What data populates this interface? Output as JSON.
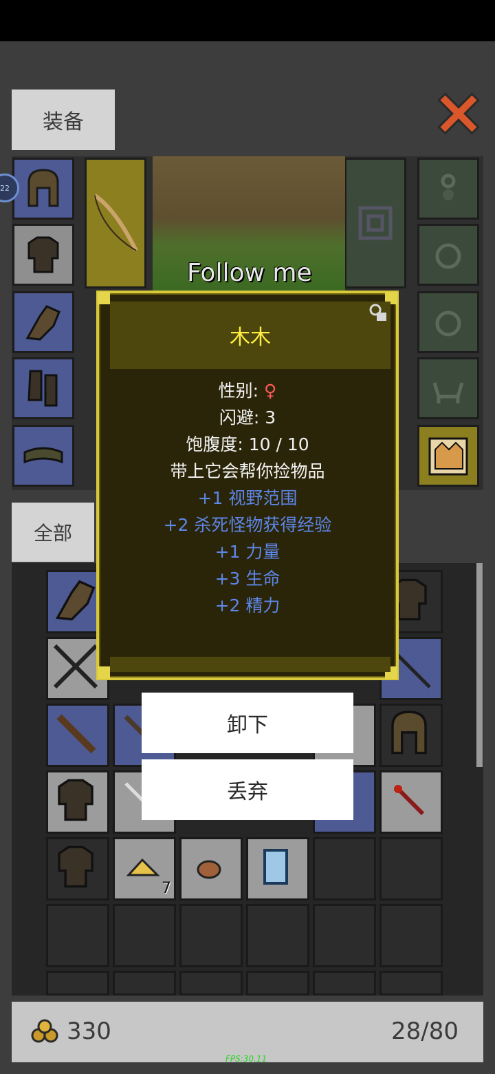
{
  "tabs": {
    "equipment": "装备",
    "all": "全部"
  },
  "scene": {
    "caption": "Follow me"
  },
  "badge": {
    "text": "22"
  },
  "tooltip": {
    "title": "木木",
    "gender_label": "性别: ",
    "gender_symbol": "♀",
    "dodge": "闪避: 3",
    "satiety": "饱腹度: 10 / 10",
    "description": "带上它会帮你捡物品",
    "bonuses": [
      "+1 视野范围",
      "+2 杀死怪物获得经验",
      "+1 力量",
      "+3 生命",
      "+2 精力"
    ]
  },
  "actions": {
    "unequip": "卸下",
    "drop": "丢弃"
  },
  "inventory": {
    "gold": "330",
    "capacity": "28/80",
    "gold_qty_item": "7"
  },
  "fps": "FPS:30.11",
  "colors": {
    "title_yellow": "#ffee44",
    "bonus_blue": "#5d86e8",
    "female_red": "#ff5a5a",
    "tooltip_border": "#d8c83a"
  }
}
